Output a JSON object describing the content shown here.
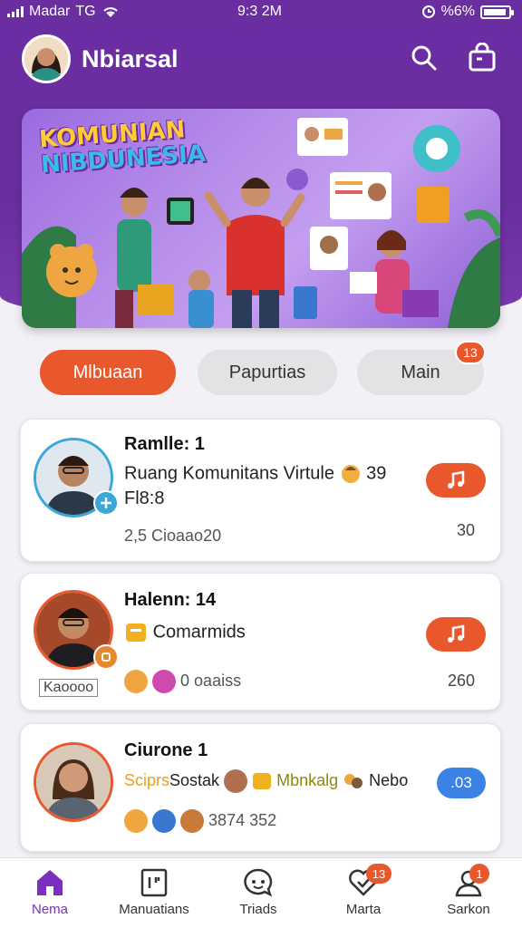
{
  "status_bar": {
    "carrier": "Madar",
    "network": "ТG",
    "time": "9:3 2M",
    "battery": "%6%"
  },
  "header": {
    "title": "Nbiarsal"
  },
  "banner": {
    "title_line1": "KOMUNIAN",
    "title_line2": "NIBDUNESIA"
  },
  "filters": [
    {
      "label": "Mlbuaan",
      "active": true
    },
    {
      "label": "Papurtias",
      "active": false
    },
    {
      "label": "Main",
      "active": false,
      "badge": "13"
    }
  ],
  "cards": [
    {
      "title": "Ramlle: 1",
      "line1": "Ruang Komunitans Virtule",
      "line1_suffix": "39",
      "line2": "Fl8:8",
      "meta": "2,5 Cioaao20",
      "count": "30",
      "action": "music"
    },
    {
      "title": "Halenn: 14",
      "line1": "Comarmids",
      "meta_tag": "Kaoooo",
      "meta": "0 oaaiss",
      "count": "260",
      "action": "music"
    },
    {
      "title": "Ciurone 1",
      "line1_a": "Sciprs",
      "line1_b": "Sostak",
      "line1_c": "Mbnkalg",
      "line1_d": "Nebo",
      "meta": "3874 352",
      "pill": ".03"
    }
  ],
  "bottom_nav": [
    {
      "label": "Nema",
      "icon": "home-icon",
      "active": true
    },
    {
      "label": "Manuatians",
      "icon": "document-icon",
      "active": false
    },
    {
      "label": "Triads",
      "icon": "chat-icon",
      "active": false
    },
    {
      "label": "Marta",
      "icon": "heart-icon",
      "active": false,
      "badge": "13"
    },
    {
      "label": "Sarkon",
      "icon": "profile-icon",
      "active": false,
      "badge": "1"
    }
  ],
  "colors": {
    "primary": "#6a2ea0",
    "accent": "#e8582c",
    "blue": "#3b82e6"
  }
}
